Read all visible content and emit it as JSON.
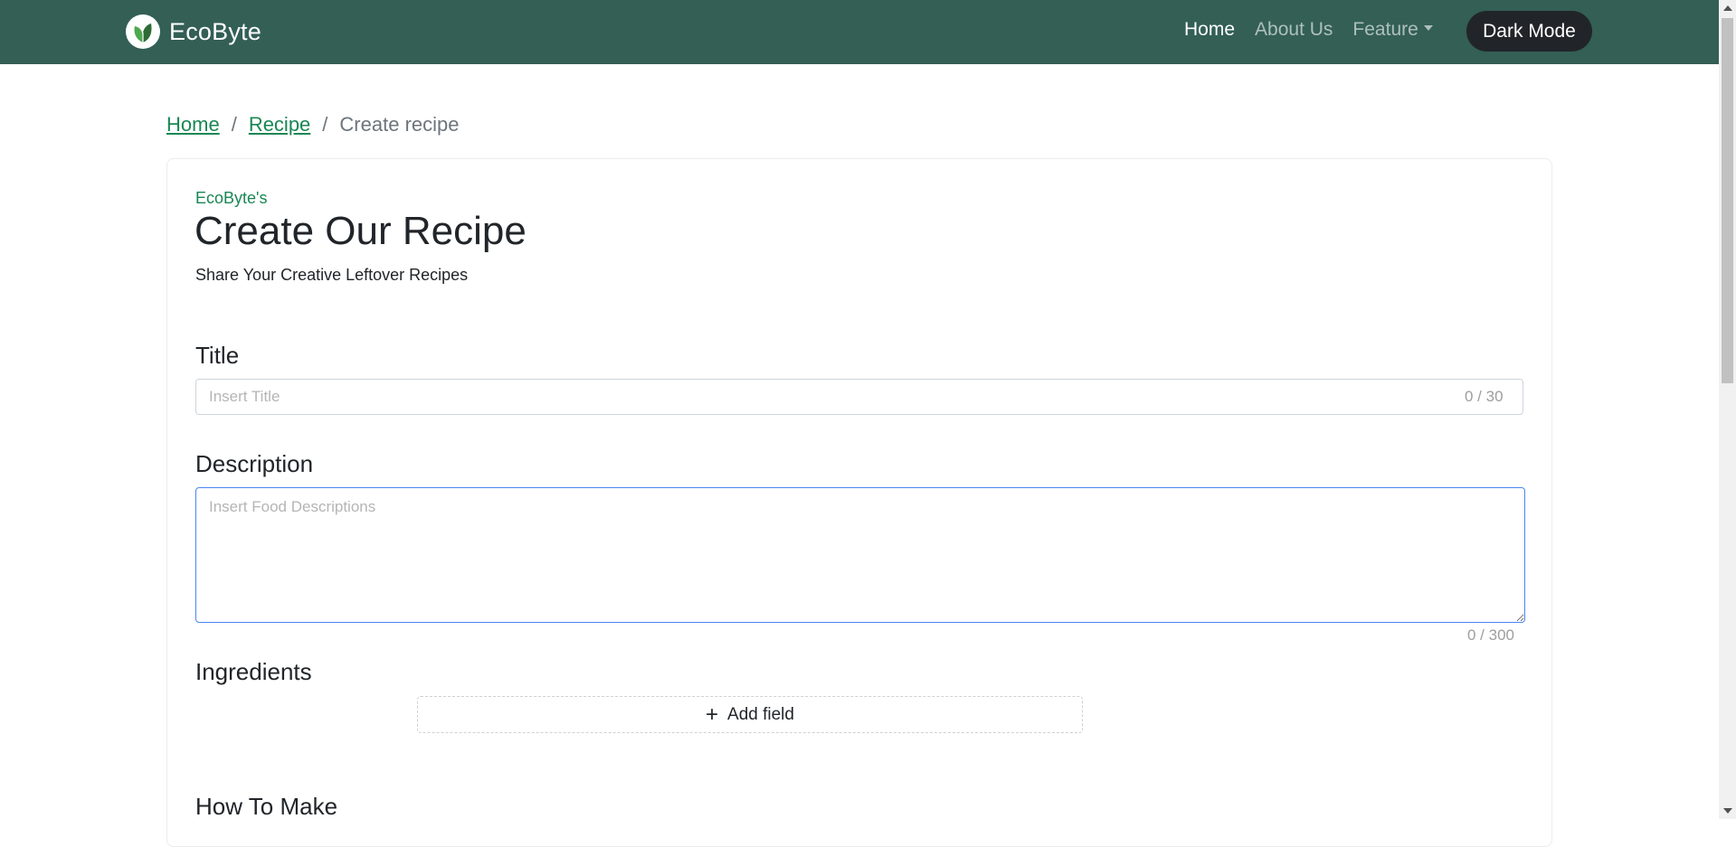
{
  "navbar": {
    "brand": "EcoByte",
    "links": [
      {
        "label": "Home",
        "active": true
      },
      {
        "label": "About Us",
        "active": false
      },
      {
        "label": "Feature",
        "active": false
      }
    ],
    "dark_mode_label": "Dark Mode"
  },
  "breadcrumb": {
    "home": "Home",
    "recipe": "Recipe",
    "current": "Create recipe",
    "separator": "/"
  },
  "card": {
    "eyebrow": "EcoByte's",
    "title": "Create Our Recipe",
    "subtitle": "Share Your Creative Leftover Recipes"
  },
  "form": {
    "title_label": "Title",
    "title_placeholder": "Insert Title",
    "title_value": "",
    "title_counter": "0 / 30",
    "description_label": "Description",
    "description_placeholder": "Insert Food Descriptions",
    "description_value": "",
    "description_counter": "0 / 300",
    "ingredients_label": "Ingredients",
    "add_field_label": "Add field",
    "how_to_make_label": "How To Make"
  },
  "colors": {
    "navbar_bg": "#335f55",
    "accent_green": "#198754",
    "dark_button": "#212529",
    "focus_blue": "#4b86f0"
  },
  "icons": [
    "leaf-logo-icon",
    "caret-down-icon",
    "plus-icon",
    "scroll-up-arrow-icon",
    "scroll-down-arrow-icon"
  ]
}
